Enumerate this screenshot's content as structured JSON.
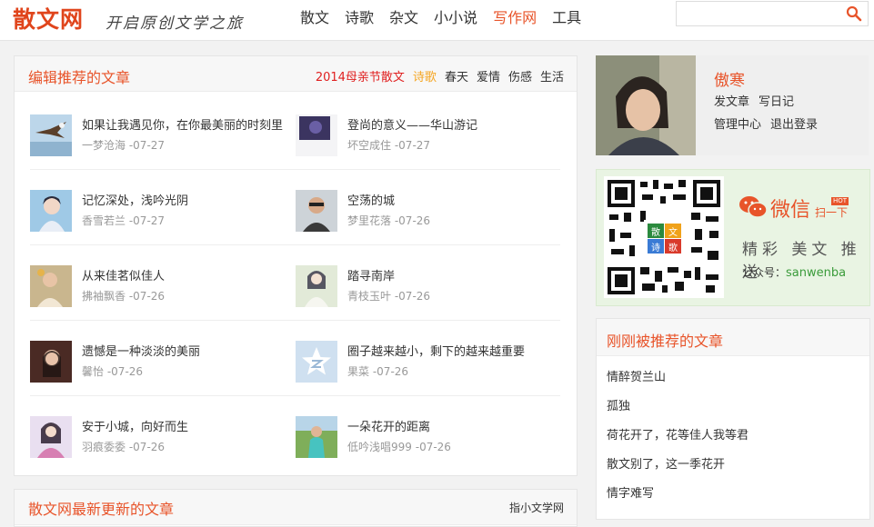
{
  "header": {
    "logo": "散文网",
    "slogan": "开启原创文学之旅",
    "nav": [
      "散文",
      "诗歌",
      "杂文",
      "小小说",
      "写作网",
      "工具"
    ],
    "nav_active_index": 4,
    "search": {
      "value": "",
      "placeholder": ""
    }
  },
  "featured": {
    "title": "编辑推荐的文章",
    "tags": [
      "2014母亲节散文",
      "诗歌",
      "春天",
      "爱情",
      "伤感",
      "生活"
    ],
    "articles": [
      {
        "title": "如果让我遇见你，在你最美丽的时刻里",
        "author": "一梦沧海",
        "date": "-07-27",
        "thumb": "eagle-thumb"
      },
      {
        "title": "登尚的意义——华山游记",
        "author": "坏空成住",
        "date": "-07-27",
        "thumb": "night-thumb"
      },
      {
        "title": "记忆深处，浅吟光阴",
        "author": "香雪若兰",
        "date": "-07-27",
        "thumb": "fairy-thumb"
      },
      {
        "title": "空荡的城",
        "author": "梦里花落",
        "date": "-07-26",
        "thumb": "man-thumb"
      },
      {
        "title": "从来佳茗似佳人",
        "author": "拂袖飘香",
        "date": "-07-26",
        "thumb": "flower-thumb"
      },
      {
        "title": "踏寻南岸",
        "author": "青枝玉叶",
        "date": "-07-26",
        "thumb": "anime-girl-thumb"
      },
      {
        "title": "遗憾是一种淡淡的美丽",
        "author": "馨怡",
        "date": "-07-26",
        "thumb": "woman-thumb"
      },
      {
        "title": "圈子越来越小，剩下的越来越重要",
        "author": "果菜",
        "date": "-07-26",
        "thumb": "default-thumb"
      },
      {
        "title": "安于小城，向好而生",
        "author": "羽痕委委",
        "date": "-07-26",
        "thumb": "costume-thumb"
      },
      {
        "title": "一朵花开的距离",
        "author": "低吟浅唱999",
        "date": "-07-26",
        "thumb": "field-thumb"
      }
    ]
  },
  "bottom_panel": {
    "title": "散文网最新更新的文章",
    "more": "指小文学网"
  },
  "user": {
    "name": "傲寒",
    "links": [
      "发文章",
      "写日记",
      "管理中心",
      "退出登录"
    ]
  },
  "wechat": {
    "title": "微信",
    "scan": "扫一下",
    "hot": "HOT",
    "tagline": "精彩 美文 推送",
    "id_label": "公众号：",
    "id_value": "sanwenba",
    "qr_center": [
      "散",
      "文",
      "诗",
      "歌"
    ]
  },
  "recent": {
    "title": "刚刚被推荐的文章",
    "items": [
      "情醉贺兰山",
      "孤独",
      "荷花开了，花等佳人我等君",
      "散文别了，这一季花开",
      "情字难写"
    ]
  },
  "colors": {
    "accent": "#e8542a",
    "tag_red": "#e02020",
    "tag_orange": "#f5a623",
    "wechat_green": "#3a9b3a"
  }
}
